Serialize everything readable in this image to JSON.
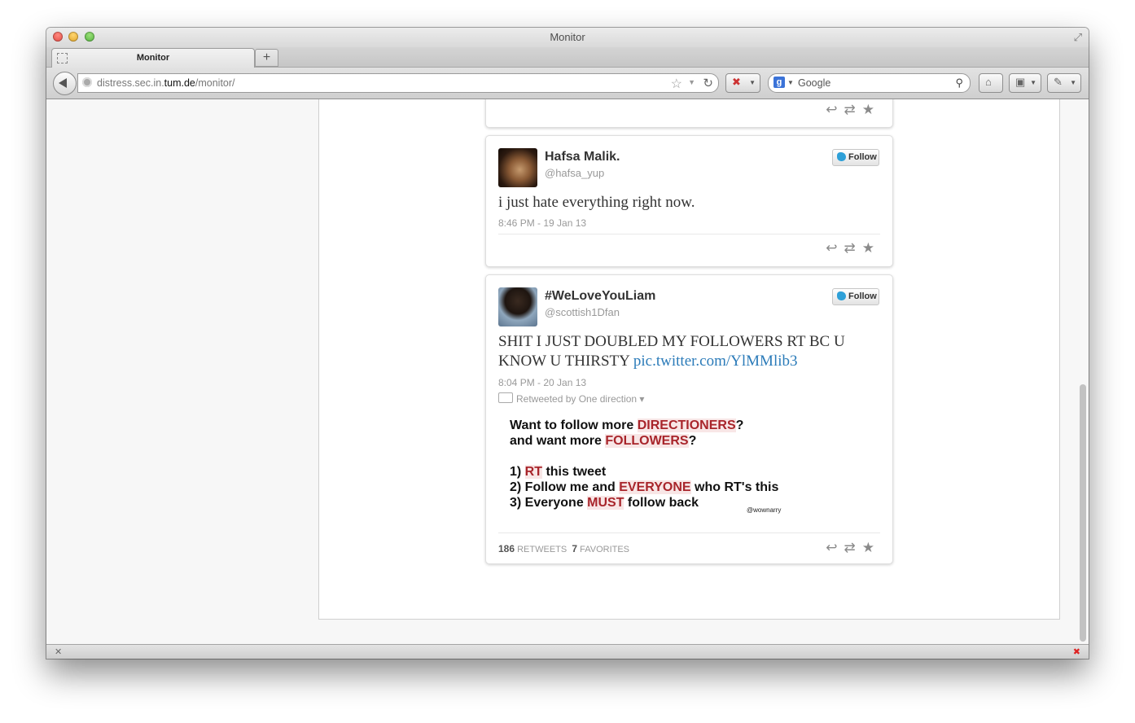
{
  "window": {
    "title": "Monitor"
  },
  "tab": {
    "label": "Monitor",
    "new_tab_label": "+"
  },
  "navbar": {
    "url_host_prefix": "distress.sec.in.",
    "url_host": "tum.de",
    "url_path": "/monitor/",
    "search_engine_glyph": "g",
    "search_placeholder": "Google"
  },
  "tweets": [
    {
      "name": "Hafsa Malik.",
      "handle": "@hafsa_yup",
      "follow_label": "Follow",
      "text": "i just hate everything right now.",
      "timestamp": "8:46 PM - 19 Jan 13"
    },
    {
      "name": "#WeLoveYouLiam",
      "handle": "@scottish1Dfan",
      "follow_label": "Follow",
      "text": "SHIT I JUST DOUBLED MY FOLLOWERS RT BC U KNOW U THIRSTY ",
      "link": "pic.twitter.com/YlMMlib3",
      "timestamp": "8:04 PM - 20 Jan 13",
      "retweeted_by": "Retweeted by One direction ▾",
      "retweets_count": "186",
      "retweets_label": "RETWEETS",
      "favorites_count": "7",
      "favorites_label": "FAVORITES",
      "image": {
        "l1a": "Want to follow more ",
        "l1b": "DIRECTIONERS",
        "l1c": "?",
        "l2a": "and want more ",
        "l2b": "FOLLOWERS",
        "l2c": "?",
        "l3a": "1) ",
        "l3b": "RT",
        "l3c": " this tweet",
        "l4a": "2) Follow me and ",
        "l4b": "EVERYONE",
        "l4c": " who RT's this",
        "l5a": "3) Everyone ",
        "l5b": "MUST",
        "l5c": " follow back",
        "watermark": "@wownarry"
      }
    }
  ],
  "icons": {
    "reply": "↩",
    "retweet": "⇄",
    "favorite": "★"
  }
}
